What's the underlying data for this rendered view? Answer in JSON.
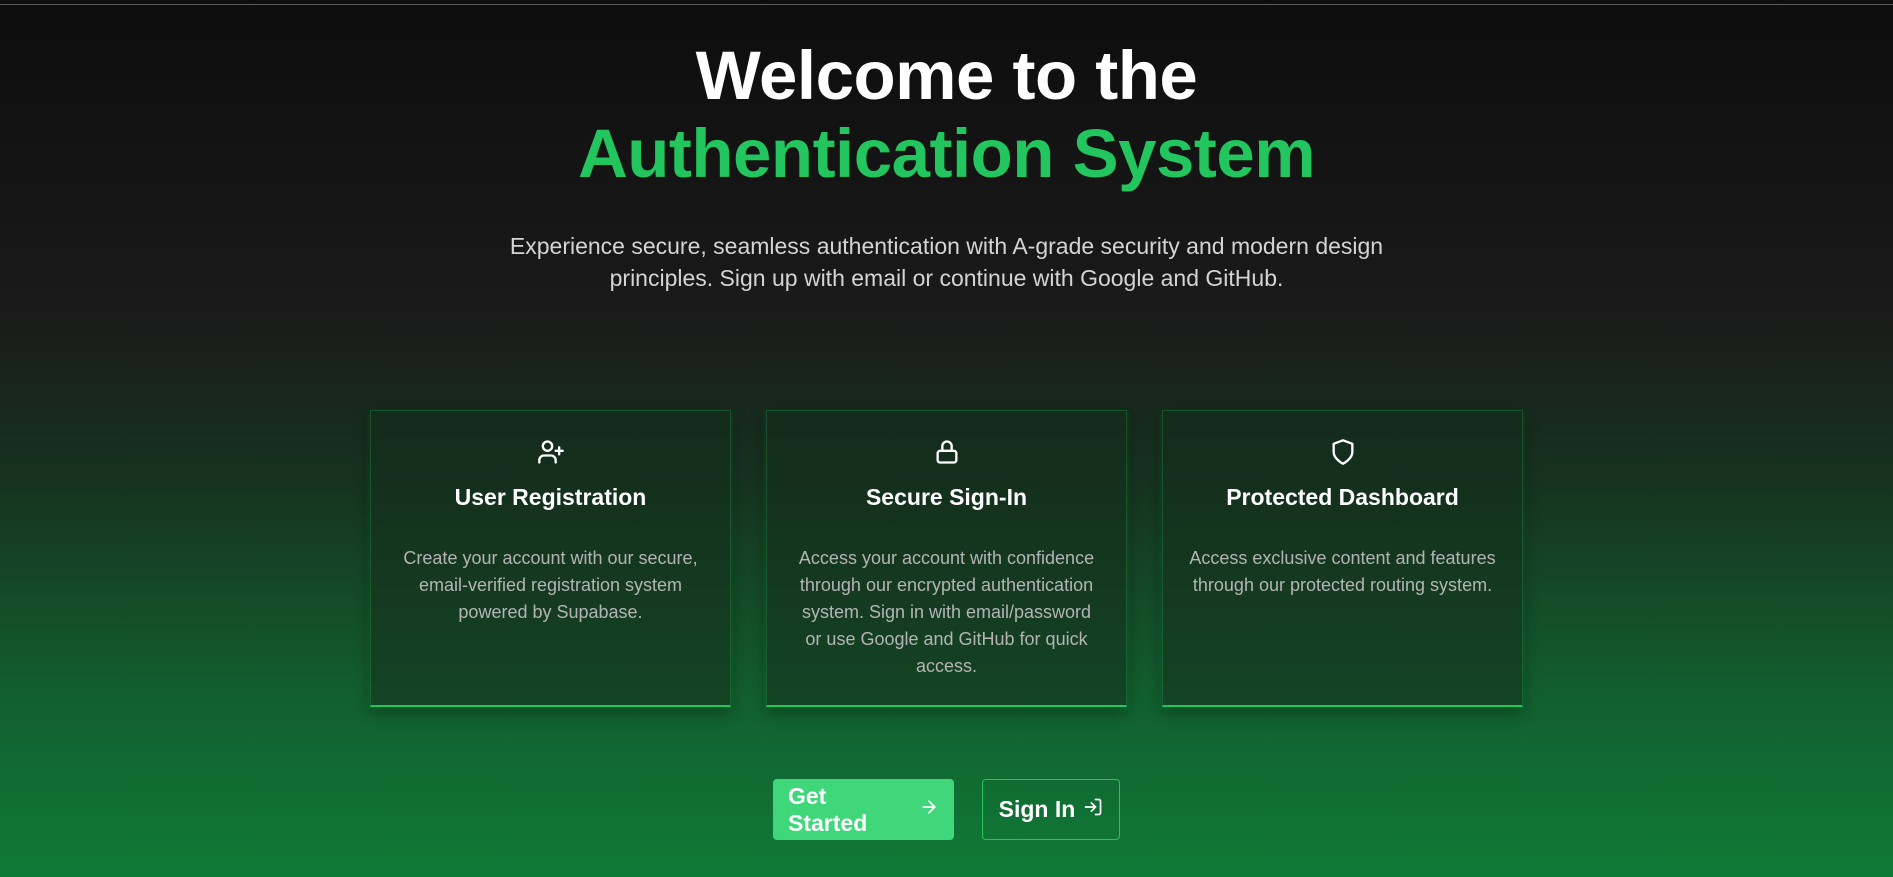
{
  "hero": {
    "title_line1": "Welcome to the",
    "title_line2": "Authentication System",
    "subtitle": "Experience secure, seamless authentication with A-grade security and modern design principles. Sign up with email or continue with Google and GitHub."
  },
  "features": [
    {
      "icon": "user-plus-icon",
      "title": "User Registration",
      "description": "Create your account with our secure, email-verified registration system powered by Supabase."
    },
    {
      "icon": "lock-icon",
      "title": "Secure Sign-In",
      "description": "Access your account with confidence through our encrypted authentication system. Sign in with email/password or use Google and GitHub for quick access."
    },
    {
      "icon": "shield-icon",
      "title": "Protected Dashboard",
      "description": "Access exclusive content and features through our protected routing system."
    }
  ],
  "actions": {
    "get_started_label": "Get Started",
    "get_started_icon": "arrow-right-icon",
    "sign_in_label": "Sign In",
    "sign_in_icon": "log-in-icon"
  },
  "colors": {
    "accent": "#22c55e",
    "button_primary": "#3fd77a",
    "background_top": "#0d0d0d",
    "background_bottom": "#0f7a36"
  }
}
